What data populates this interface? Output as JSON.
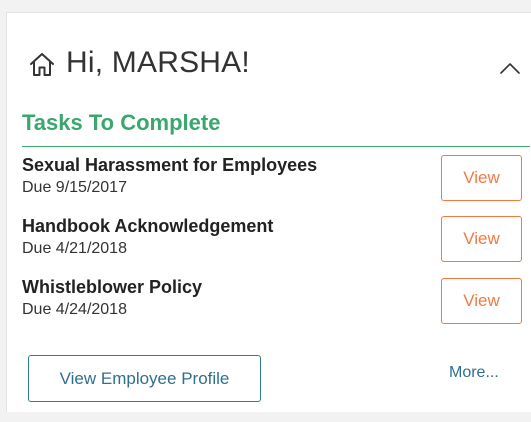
{
  "widget": {
    "greeting": "Hi, MARSHA!",
    "home_icon": "home-icon",
    "collapse_icon": "chevron-up-icon"
  },
  "tasks_section": {
    "heading": "Tasks To Complete",
    "tasks": [
      {
        "title": "Sexual Harassment for Employees",
        "due": "Due 9/15/2017",
        "action_label": "View"
      },
      {
        "title": "Handbook Acknowledgement",
        "due": "Due 4/21/2018",
        "action_label": "View"
      },
      {
        "title": "Whistleblower Policy",
        "due": "Due 4/24/2018",
        "action_label": "View"
      }
    ]
  },
  "footer": {
    "profile_button_label": "View Employee Profile",
    "more_link_label": "More..."
  },
  "colors": {
    "accent_green": "#3aa76d",
    "action_orange": "#f07a44",
    "link_blue": "#2f6f8e"
  }
}
